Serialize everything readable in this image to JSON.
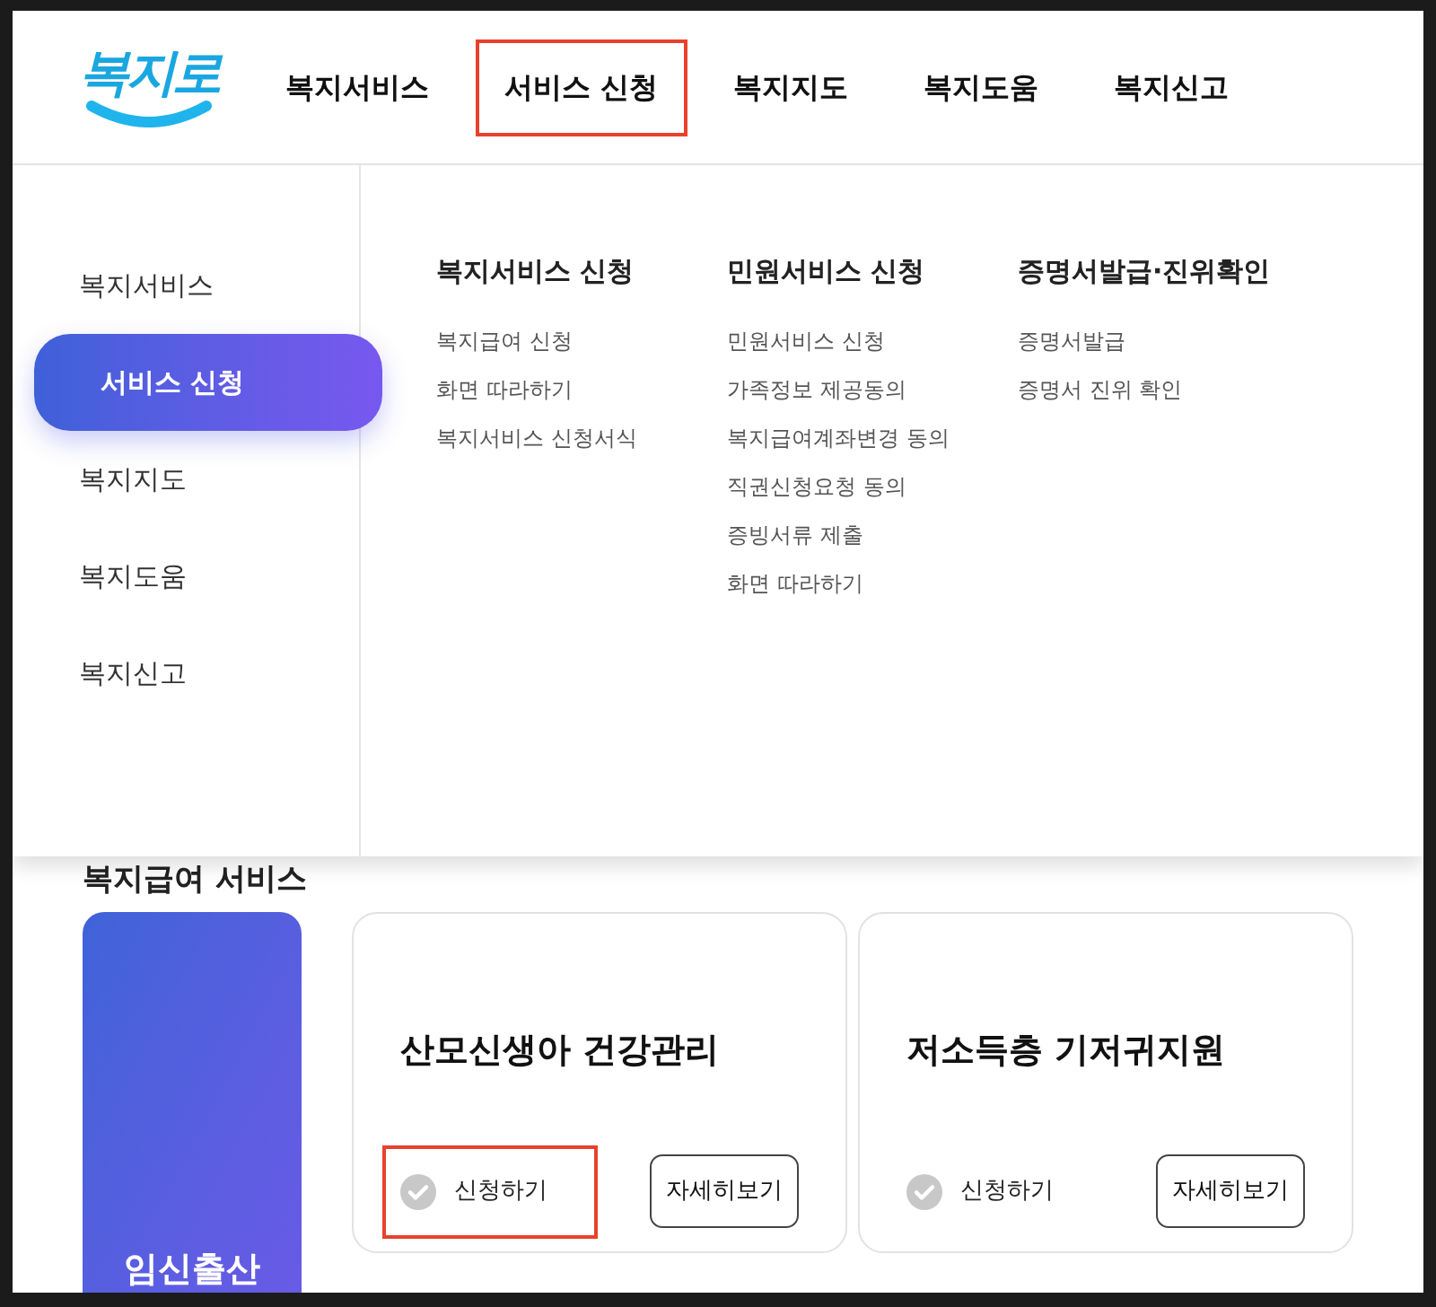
{
  "logo": {
    "text": "복지로"
  },
  "nav": [
    {
      "label": "복지서비스",
      "highlighted": false
    },
    {
      "label": "서비스 신청",
      "highlighted": true
    },
    {
      "label": "복지지도",
      "highlighted": false
    },
    {
      "label": "복지도움",
      "highlighted": false
    },
    {
      "label": "복지신고",
      "highlighted": false
    }
  ],
  "menu": {
    "side": [
      {
        "label": "복지서비스",
        "selected": false
      },
      {
        "label": "서비스 신청",
        "selected": true
      },
      {
        "label": "복지지도",
        "selected": false
      },
      {
        "label": "복지도움",
        "selected": false
      },
      {
        "label": "복지신고",
        "selected": false
      }
    ],
    "columns": [
      {
        "title": "복지서비스 신청",
        "items": [
          "복지급여 신청",
          "화면 따라하기",
          "복지서비스 신청서식"
        ]
      },
      {
        "title": "민원서비스 신청",
        "items": [
          "민원서비스 신청",
          "가족정보 제공동의",
          "복지급여계좌변경 동의",
          "직권신청요청 동의",
          "증빙서류 제출",
          "화면 따라하기"
        ]
      },
      {
        "title": "증명서발급·진위확인",
        "items": [
          "증명서발급",
          "증명서 진위 확인"
        ]
      }
    ]
  },
  "section": {
    "title": "복지급여 서비스"
  },
  "feature_card": {
    "title": "임신출산"
  },
  "cards": [
    {
      "title": "산모신생아 건강관리",
      "apply": "신청하기",
      "apply_highlighted": true,
      "details": "자세히보기"
    },
    {
      "title": "저소득층 기저귀지원",
      "apply": "신청하기",
      "apply_highlighted": false,
      "details": "자세히보기"
    }
  ]
}
